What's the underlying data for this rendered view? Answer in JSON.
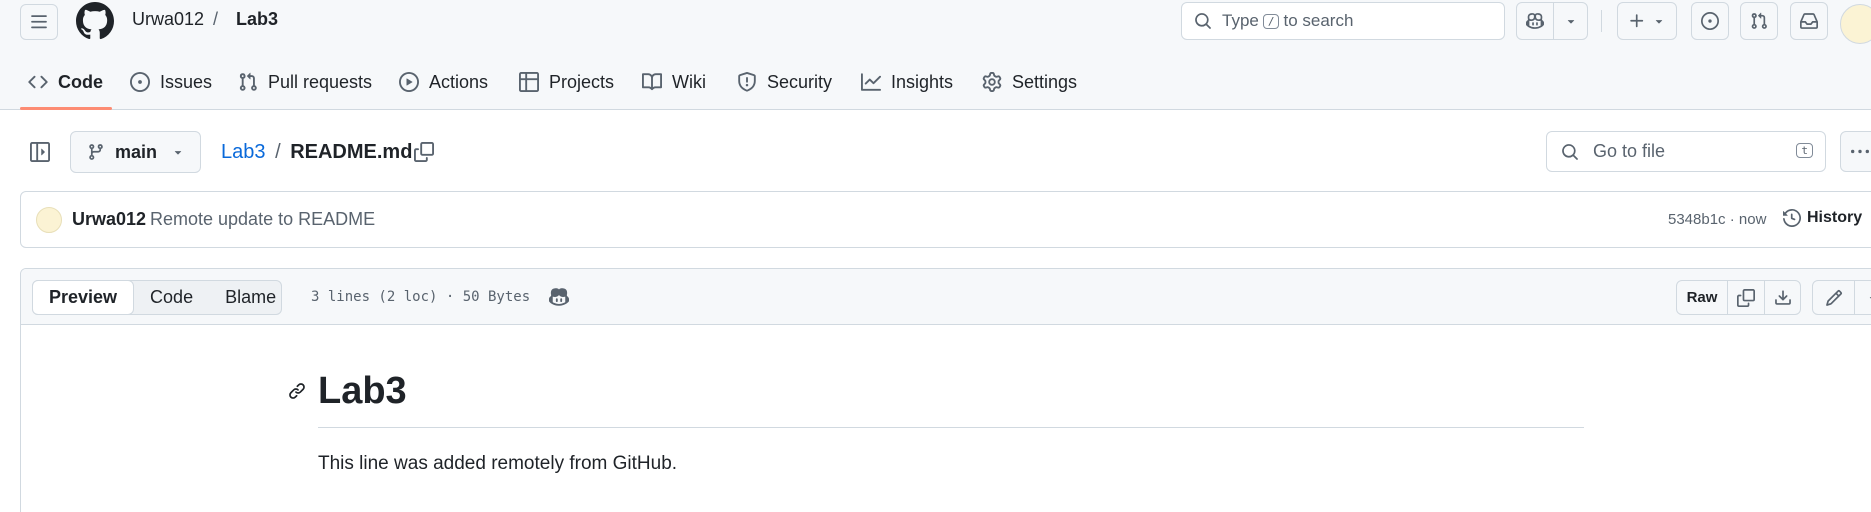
{
  "header": {
    "owner": "Urwa012",
    "separator": "/",
    "repo": "Lab3",
    "search": {
      "prefix": "Type",
      "key": "/",
      "suffix": "to search"
    }
  },
  "nav": {
    "items": [
      {
        "label": "Code",
        "icon": "code-icon"
      },
      {
        "label": "Issues",
        "icon": "issue-opened-icon"
      },
      {
        "label": "Pull requests",
        "icon": "git-pull-request-icon"
      },
      {
        "label": "Actions",
        "icon": "play-icon"
      },
      {
        "label": "Projects",
        "icon": "table-icon"
      },
      {
        "label": "Wiki",
        "icon": "book-icon"
      },
      {
        "label": "Security",
        "icon": "shield-icon"
      },
      {
        "label": "Insights",
        "icon": "graph-icon"
      },
      {
        "label": "Settings",
        "icon": "gear-icon"
      }
    ],
    "active": "Code"
  },
  "file_header": {
    "branch": "main",
    "path_repo": "Lab3",
    "path_sep": "/",
    "path_file": "README.md",
    "goto_placeholder": "Go to file",
    "goto_key": "t"
  },
  "commit": {
    "author": "Urwa012",
    "message": "Remote update to README",
    "hash_time": "5348b1c · now",
    "history_label": "History"
  },
  "viewer": {
    "tabs": [
      "Preview",
      "Code",
      "Blame"
    ],
    "active_tab": "Preview",
    "meta": "3 lines (2 loc) · 50 Bytes",
    "raw_label": "Raw"
  },
  "readme": {
    "heading": "Lab3",
    "paragraph": "This line was added remotely from GitHub."
  },
  "colors": {
    "accent_underline": "#fd8c73",
    "link": "#0969da",
    "border": "#d1d9e0",
    "muted_text": "#59636e"
  }
}
